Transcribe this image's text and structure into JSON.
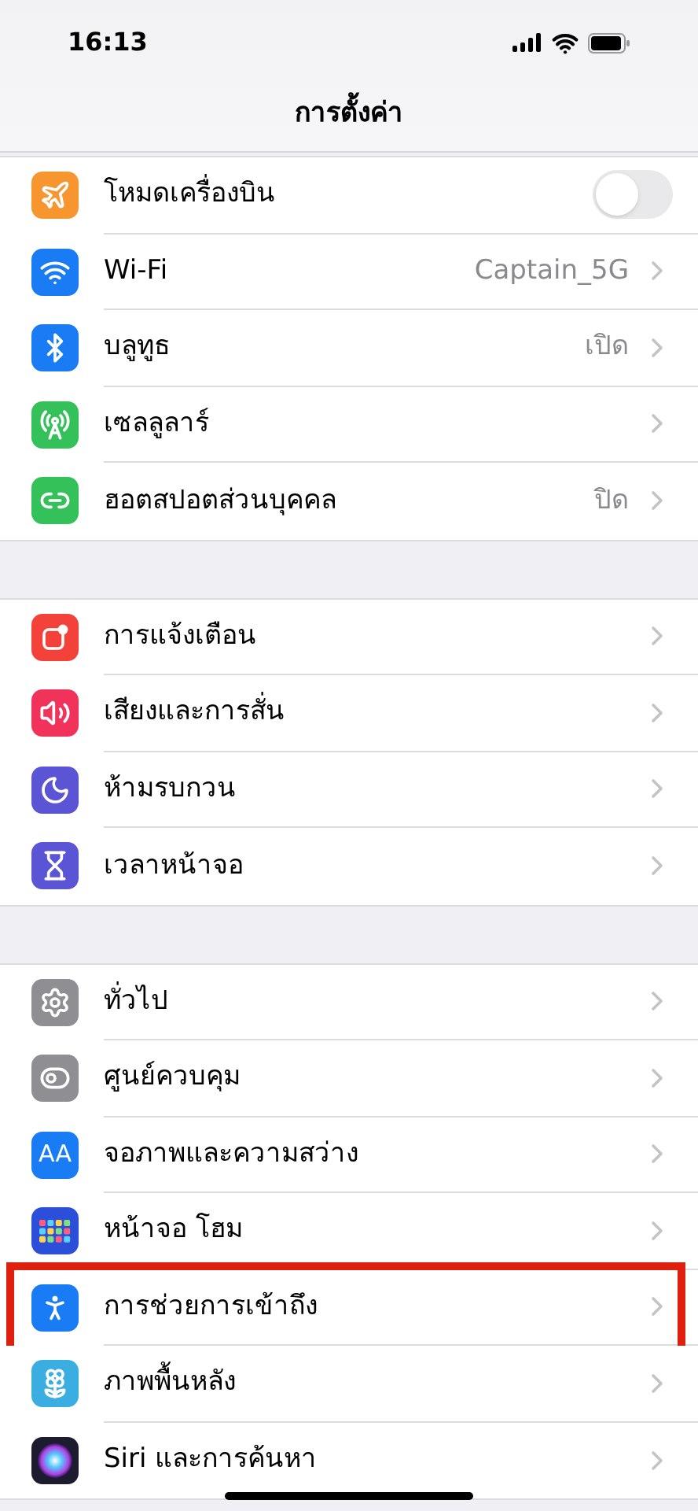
{
  "status_bar": {
    "time": "16:13"
  },
  "nav": {
    "title": "การตั้งค่า"
  },
  "groups": [
    {
      "items": [
        {
          "color": "#f7962f",
          "label": "โหมดเครื่องบิน",
          "kind": "toggle",
          "on": false,
          "highlighted": false
        },
        {
          "color": "#1a7cf5",
          "label": "Wi-Fi",
          "value": "Captain_5G",
          "kind": "link",
          "highlighted": false
        },
        {
          "color": "#1a7cf5",
          "label": "บลูทูธ",
          "value": "เปิด",
          "kind": "link",
          "highlighted": false
        },
        {
          "color": "#34c15a",
          "label": "เซลลูลาร์",
          "kind": "link",
          "highlighted": false
        },
        {
          "color": "#34c15a",
          "label": "ฮอตสปอตส่วนบุคคล",
          "value": "ปิด",
          "kind": "link",
          "highlighted": false
        }
      ]
    },
    {
      "items": [
        {
          "color": "#f2423a",
          "label": "การแจ้งเตือน",
          "kind": "link",
          "highlighted": false
        },
        {
          "color": "#f1325a",
          "label": "เสียงและการสั่น",
          "kind": "link",
          "highlighted": false
        },
        {
          "color": "#5b55d6",
          "label": "ห้ามรบกวน",
          "kind": "link",
          "highlighted": false
        },
        {
          "color": "#5b55d6",
          "label": "เวลาหน้าจอ",
          "kind": "link",
          "highlighted": false
        }
      ]
    },
    {
      "items": [
        {
          "color": "#8e8e93",
          "label": "ทั่วไป",
          "kind": "link",
          "highlighted": false
        },
        {
          "color": "#8e8e93",
          "label": "ศูนย์ควบคุม",
          "kind": "link",
          "highlighted": false
        },
        {
          "icon_text": "AA",
          "color": "#1a7cf5",
          "label": "จอภาพและความสว่าง",
          "kind": "link",
          "highlighted": false
        },
        {
          "color": "#2b4fd8",
          "label": "หน้าจอ โฮม",
          "kind": "link",
          "highlighted": false
        },
        {
          "color": "#1a7cf5",
          "label": "การช่วยการเข้าถึง",
          "kind": "link",
          "highlighted": true
        },
        {
          "color": "#3aaee0",
          "label": "ภาพพื้นหลัง",
          "kind": "link",
          "highlighted": false
        },
        {
          "color": "#1c1c2e",
          "label": "Siri และการค้นหา",
          "kind": "link",
          "highlighted": false
        }
      ]
    }
  ]
}
